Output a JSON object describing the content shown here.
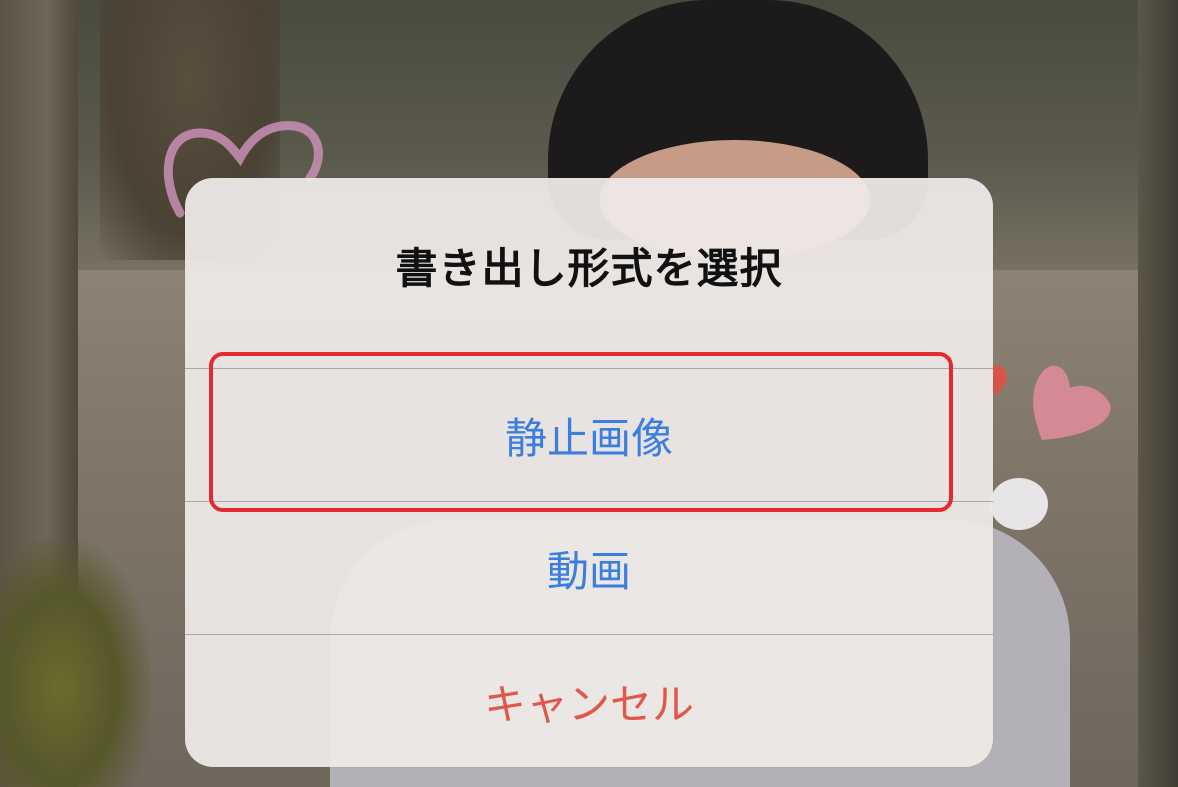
{
  "dialog": {
    "title": "書き出し形式を選択",
    "actions": [
      {
        "label": "静止画像",
        "style": "default",
        "highlighted": true
      },
      {
        "label": "動画",
        "style": "default",
        "highlighted": false
      },
      {
        "label": "キャンセル",
        "style": "cancel",
        "highlighted": false
      }
    ]
  },
  "colors": {
    "action_blue": "#3a7ee0",
    "cancel_red": "#e0584a",
    "highlight_red": "#e22a2f",
    "title_black": "#111111"
  },
  "decorations": [
    "heart-outline-icon",
    "heart-icon"
  ]
}
